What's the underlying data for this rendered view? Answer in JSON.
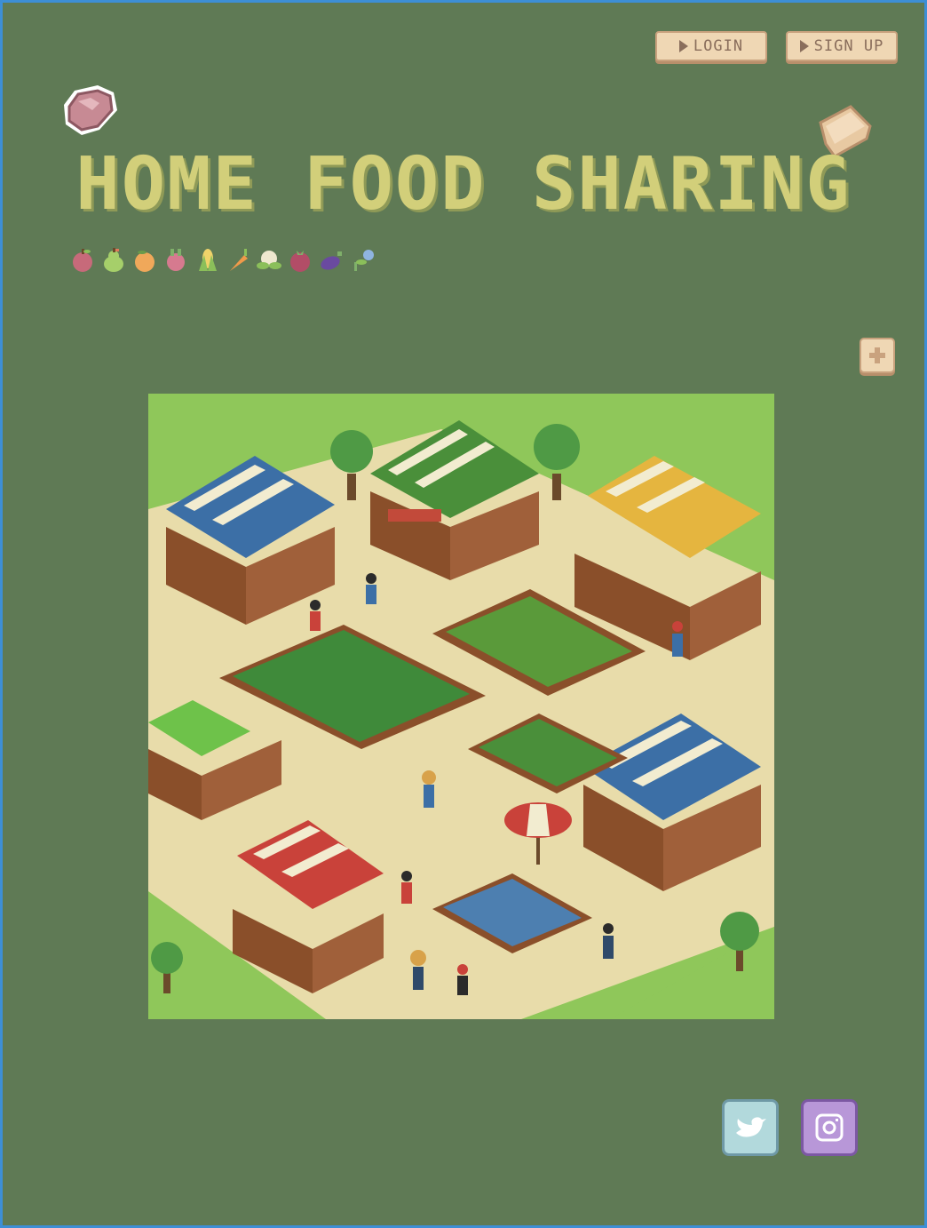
{
  "header": {
    "login_label": "LOGIN",
    "signup_label": "SIGN UP"
  },
  "hero": {
    "title": "HOME FOOD SHARING"
  },
  "produce_icons": [
    "apple-icon",
    "pear-icon",
    "peach-icon",
    "beet-icon",
    "corn-icon",
    "carrot-icon",
    "cauliflower-icon",
    "pomegranate-icon",
    "eggplant-icon",
    "sprout-icon"
  ],
  "social": {
    "twitter": "twitter-icon",
    "instagram": "instagram-icon"
  },
  "colors": {
    "background": "#5f7a55",
    "title": "#d2cf7a",
    "button_bg": "#efd7b4",
    "button_text": "#8a6e5c"
  }
}
